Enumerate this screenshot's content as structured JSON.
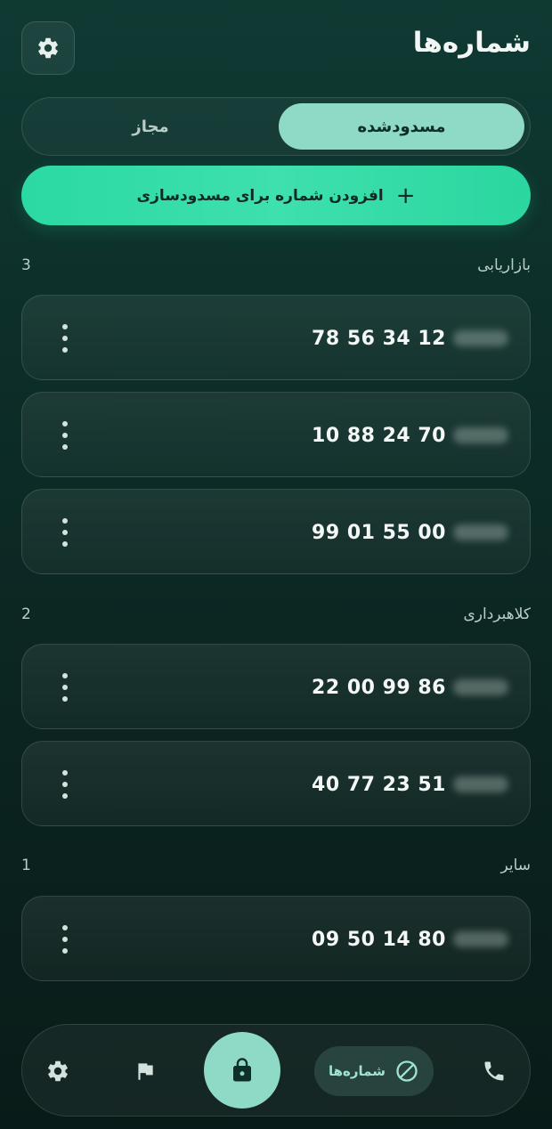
{
  "header": {
    "title": "شماره‌ها"
  },
  "tabs": [
    {
      "label": "مسدودشده",
      "active": true
    },
    {
      "label": "مجاز",
      "active": false
    }
  ],
  "add_button": {
    "label": "افزودن شماره برای مسدودسازی"
  },
  "sections": [
    {
      "name": "بازاریابی",
      "count": "3",
      "numbers": [
        "78 56 34 12",
        "10 88 24 70",
        "99 01 55 00"
      ]
    },
    {
      "name": "کلاهبرداری",
      "count": "2",
      "numbers": [
        "22 00 99 86",
        "40 77 23 51"
      ]
    },
    {
      "name": "سایر",
      "count": "1",
      "numbers": [
        "09 50 14 80"
      ]
    }
  ],
  "bottom_nav": {
    "active_label": "شماره‌ها"
  },
  "colors": {
    "accent": "#8fd9c7",
    "add_button": "#2bd9a2",
    "background": "#0d2e29"
  }
}
